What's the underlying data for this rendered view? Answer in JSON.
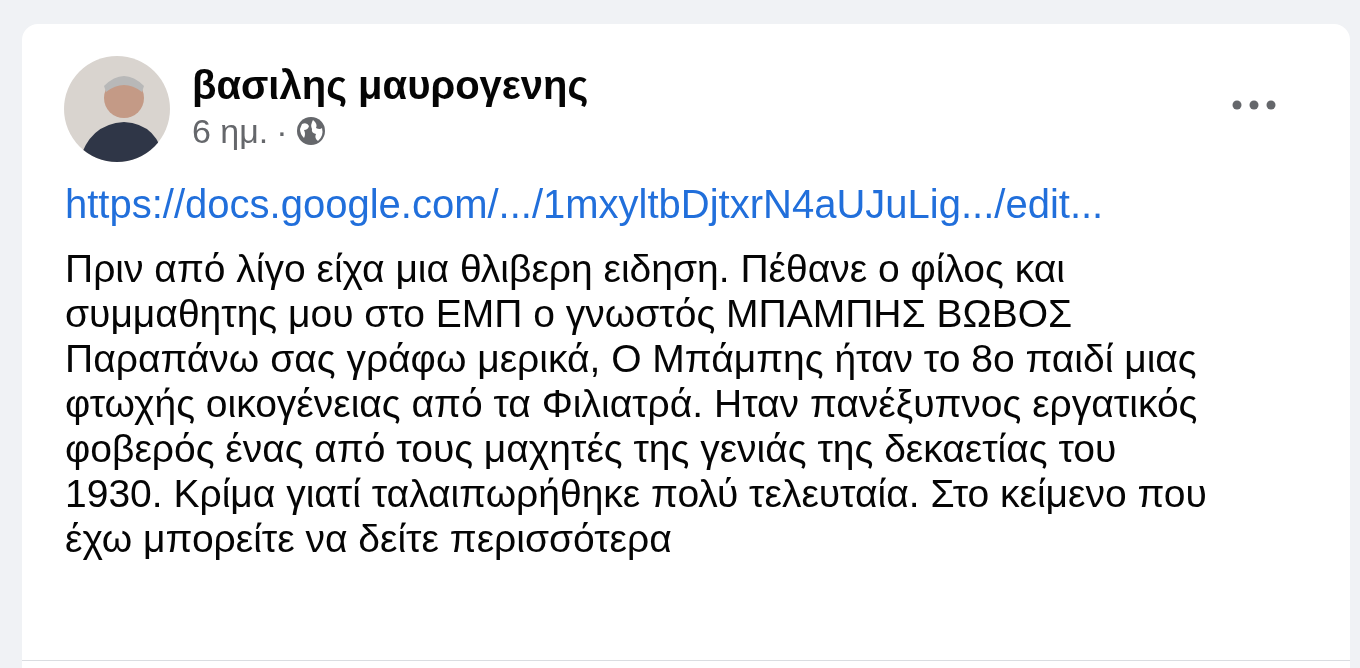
{
  "post": {
    "author": "βασιλης μαυρογενης",
    "time": "6 ημ.",
    "separator": "·",
    "link": "https://docs.google.com/.../1mxyltbDjtxrN4aUJuLig.../edit...",
    "body_lines": [
      "Πριν από λίγο είχα μια θλιβερη ειδηση. Πέθανε ο φίλος και",
      "συμμαθητης μου στο ΕΜΠ ο γνωστός ΜΠΑΜΠΗΣ ΒΩΒΟΣ",
      "Παραπάνω σας γράφω μερικά, Ο Μπάμπης ήταν το 8ο παιδί μιας",
      "φτωχής οικογένειας από τα Φιλιατρά. Ηταν πανέξυπνος εργατικός",
      "φοβερός ένας από τους μαχητές της γενιάς της δεκαετίας του",
      "1930. Κρίμα γιατί ταλαιπωρήθηκε πολύ τελευταία. Στο κείμενο που",
      "έχω μπορείτε να δείτε περισσότερα"
    ]
  }
}
